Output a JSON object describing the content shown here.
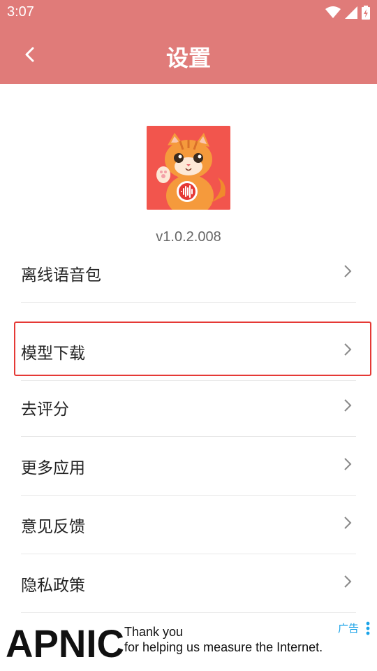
{
  "status_bar": {
    "time": "3:07"
  },
  "header": {
    "title": "设置",
    "accent_color": "#e07b79"
  },
  "app": {
    "version": "v1.0.2.008",
    "logo_icon": "orange-cat-voice-icon"
  },
  "menu": {
    "items": [
      {
        "label": "离线语音包"
      },
      {
        "label": "模型下载"
      },
      {
        "label": "去评分"
      },
      {
        "label": "更多应用"
      },
      {
        "label": "意见反馈"
      },
      {
        "label": "隐私政策"
      }
    ]
  },
  "ad": {
    "logo_text": "APNIC",
    "line1": "Thank you",
    "line2": "for helping us measure the Internet.",
    "badge": "广告"
  }
}
